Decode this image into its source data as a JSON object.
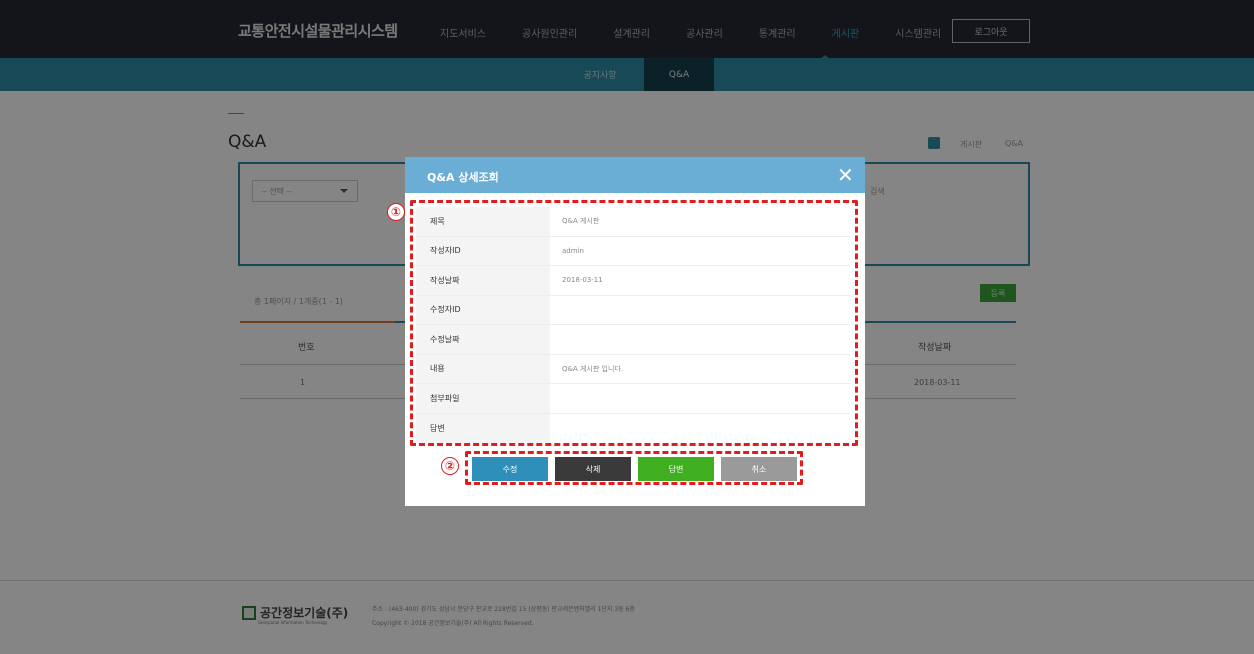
{
  "header": {
    "app_title": "교통안전시설물관리시스템",
    "nav": [
      "지도서비스",
      "공사원인관리",
      "설계관리",
      "공사관리",
      "통계관리",
      "게시판",
      "시스템관리"
    ],
    "active_nav": "게시판",
    "logout_label": "로그아웃"
  },
  "subnav": {
    "items": [
      "공지사항",
      "Q&A"
    ],
    "active": "Q&A"
  },
  "page": {
    "title": "Q&A",
    "breadcrumb": [
      "게시판",
      "Q&A"
    ],
    "search": {
      "select_value": "-- 선택 --",
      "search_label": "검색"
    },
    "list_count": "총 1페이지 / 1개중(1 - 1)",
    "register_label": "등록",
    "table": {
      "headers": [
        "번호",
        "작성날짜"
      ],
      "rows": [
        {
          "no": "1",
          "date": "2018-03-11"
        }
      ]
    }
  },
  "modal": {
    "title": "Q&A 상세조회",
    "close_icon": "close-icon",
    "fields": [
      {
        "label": "제목",
        "value": "Q&A 게시판"
      },
      {
        "label": "작성자ID",
        "value": "admin"
      },
      {
        "label": "작성날짜",
        "value": "2018-03-11"
      },
      {
        "label": "수정자ID",
        "value": ""
      },
      {
        "label": "수정날짜",
        "value": ""
      },
      {
        "label": "내용",
        "value": "Q&A 게시판 입니다."
      },
      {
        "label": "첨부파일",
        "value": ""
      },
      {
        "label": "답변",
        "value": ""
      }
    ],
    "buttons": {
      "edit": "수정",
      "delete": "삭제",
      "answer": "답변",
      "cancel": "취소"
    },
    "annotations": [
      "①",
      "②"
    ]
  },
  "footer": {
    "company": "공간정보기술(주)",
    "company_sub": "Geospatial Information Technology",
    "address": "주소 : (463-400) 경기도 성남시 분당구 판교로 228번길 15 (삼평동) 판교세븐벤처밸리 1단지 3동 6층",
    "copyright": "Copyright © 2018 공간정보기술(주) All Rights Reserved."
  },
  "colors": {
    "header_bg": "#262a33",
    "subnav_bg": "#2c8da6",
    "modal_header": "#6aadd5",
    "annotation_red": "#e21c1c",
    "btn_edit": "#2f8fbb",
    "btn_delete": "#3a3a3a",
    "btn_answer": "#3fae1f",
    "btn_cancel": "#9a9a9a"
  }
}
